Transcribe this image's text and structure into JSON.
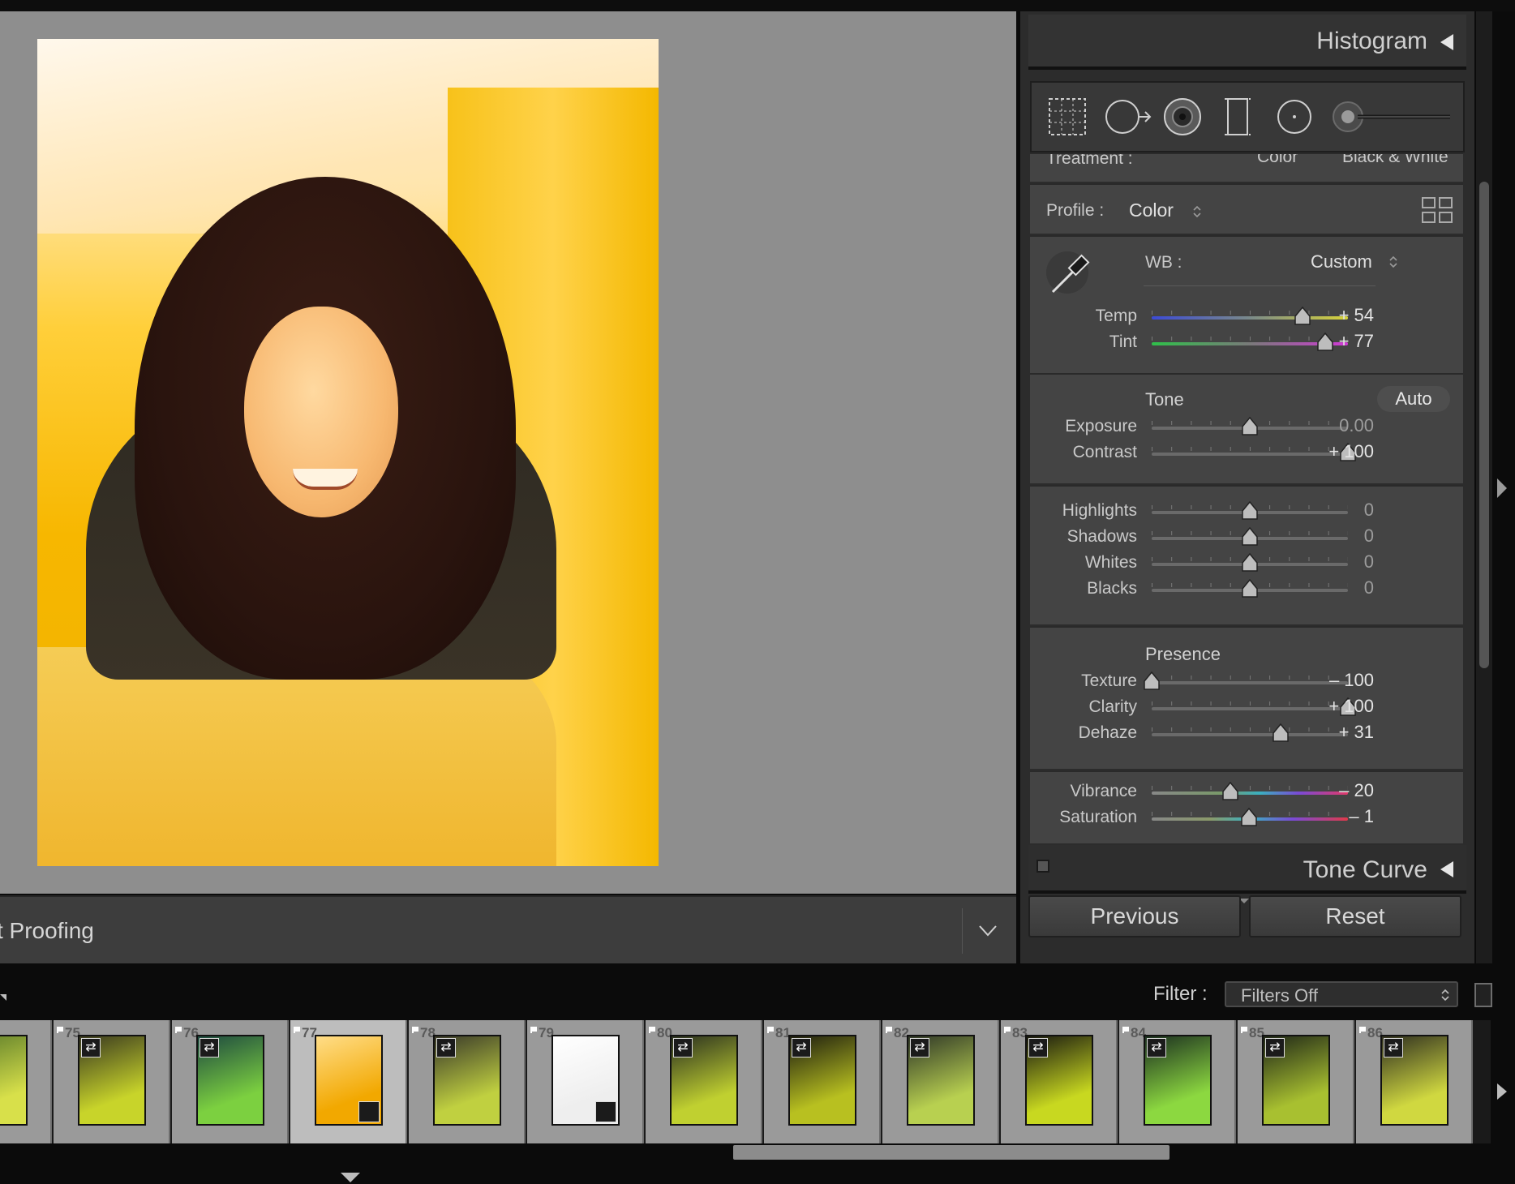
{
  "toolbar": {
    "label": "t Proofing"
  },
  "panel": {
    "histogram": {
      "title": "Histogram"
    },
    "treatment": {
      "label": "Treatment :",
      "color": "Color",
      "bw": "Black & White"
    },
    "profile": {
      "label": "Profile :",
      "value": "Color"
    },
    "wb": {
      "label": "WB :",
      "value": "Custom"
    },
    "temp": {
      "label": "Temp",
      "value": "+ 54",
      "position": 0.77
    },
    "tint": {
      "label": "Tint",
      "value": "+ 77",
      "position": 0.885
    },
    "tone": {
      "heading": "Tone",
      "auto": "Auto"
    },
    "exposure": {
      "label": "Exposure",
      "value": "0.00",
      "position": 0.5
    },
    "contrast": {
      "label": "Contrast",
      "value": "+ 100",
      "position": 1.0
    },
    "highlights": {
      "label": "Highlights",
      "value": "0",
      "position": 0.5
    },
    "shadows": {
      "label": "Shadows",
      "value": "0",
      "position": 0.5
    },
    "whites": {
      "label": "Whites",
      "value": "0",
      "position": 0.5
    },
    "blacks": {
      "label": "Blacks",
      "value": "0",
      "position": 0.5
    },
    "presence": {
      "heading": "Presence"
    },
    "texture": {
      "label": "Texture",
      "value": "– 100",
      "position": 0.0
    },
    "clarity": {
      "label": "Clarity",
      "value": "+ 100",
      "position": 1.0
    },
    "dehaze": {
      "label": "Dehaze",
      "value": "+ 31",
      "position": 0.655
    },
    "vibrance": {
      "label": "Vibrance",
      "value": "– 20",
      "position": 0.4
    },
    "saturation": {
      "label": "Saturation",
      "value": "– 1",
      "position": 0.495
    },
    "tone_curve": {
      "title": "Tone Curve"
    },
    "previous": "Previous",
    "reset": "Reset"
  },
  "filter": {
    "label": "Filter :",
    "value": "Filters Off"
  },
  "filmstrip": {
    "items": [
      {
        "num": "",
        "colors": [
          "#5a7a2a",
          "#d8e04a"
        ]
      },
      {
        "num": "75",
        "colors": [
          "#3a3a20",
          "#c8d42a"
        ]
      },
      {
        "num": "76",
        "colors": [
          "#1e4a40",
          "#7cd040"
        ]
      },
      {
        "num": "77",
        "colors": [
          "#ffdd88",
          "#f2a800"
        ],
        "selected": true
      },
      {
        "num": "78",
        "colors": [
          "#3a3a2a",
          "#c0d040"
        ]
      },
      {
        "num": "79",
        "colors": [
          "#ffffff",
          "#eeeeee"
        ]
      },
      {
        "num": "80",
        "colors": [
          "#2a3020",
          "#c0d030"
        ]
      },
      {
        "num": "81",
        "colors": [
          "#1e1e10",
          "#b8c020"
        ]
      },
      {
        "num": "82",
        "colors": [
          "#303828",
          "#b8d050"
        ]
      },
      {
        "num": "83",
        "colors": [
          "#1a1a10",
          "#c8d820"
        ]
      },
      {
        "num": "84",
        "colors": [
          "#1c3020",
          "#8cd840"
        ]
      },
      {
        "num": "85",
        "colors": [
          "#202818",
          "#a8c030"
        ]
      },
      {
        "num": "86",
        "colors": [
          "#303020",
          "#d0d840"
        ]
      }
    ]
  }
}
